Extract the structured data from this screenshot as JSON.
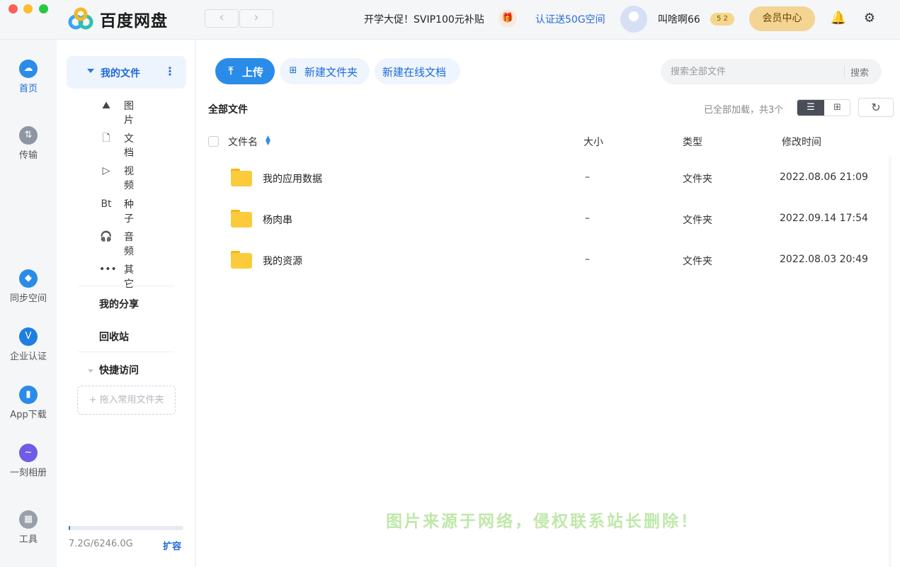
{
  "app": {
    "title": "百度网盘",
    "logo_colors": [
      "#37a3f5",
      "#2ec1a9",
      "#f5b72a"
    ]
  },
  "traffic_lights": [
    "#fe5f57",
    "#febc2e",
    "#28c840"
  ],
  "topbar": {
    "back_icon": "‹",
    "forward_icon": "›",
    "promo_text": "开学大促！SVIP100元补贴",
    "gift_icon": "🎁",
    "auth_text": "认证送50G空间",
    "username": "叫啥啊66",
    "vip_badge": "5  2",
    "member_label": "会员中心",
    "bell_icon": "🔔",
    "settings_icon": "⚙"
  },
  "leftnav": [
    {
      "label": "首页",
      "icon": "☁",
      "color": "#2a8ce8"
    },
    {
      "label": "传输",
      "icon": "⇅",
      "color": "#8f96a3"
    },
    {
      "label": "同步空间",
      "icon": "◆",
      "color": "#2a8ce8"
    },
    {
      "label": "企业认证",
      "icon": "V",
      "color": "#1f7fe0"
    },
    {
      "label": "App下载",
      "icon": "▮",
      "color": "#2a8ce8"
    },
    {
      "label": "一刻相册",
      "icon": "~",
      "color": "#6c5ce7"
    },
    {
      "label": "工具",
      "icon": "▦",
      "color": "#9aa0aa"
    }
  ],
  "sidebar": {
    "my_files": "我的文件",
    "more_icon": "⋮",
    "categories": [
      {
        "label": "图片",
        "icon": "⛰"
      },
      {
        "label": "文档",
        "icon": "🗋"
      },
      {
        "label": "视频",
        "icon": "▷"
      },
      {
        "label": "种子",
        "icon": "Bt"
      },
      {
        "label": "音频",
        "icon": "🎧"
      },
      {
        "label": "其它",
        "icon": "•••"
      }
    ],
    "my_share": "我的分享",
    "recycle": "回收站",
    "quick_access": "快捷访问",
    "drop_hint": "+ 拖入常用文件夹",
    "storage_text": "7.2G/6246.0G",
    "storage_used": 0.0012,
    "expand_label": "扩容"
  },
  "toolbar": {
    "upload_label": "上传",
    "upload_icon": "⤒",
    "new_folder_label": "新建文件夹",
    "new_folder_icon": "⊞",
    "new_doc_label": "新建在线文档",
    "search_placeholder": "搜索全部文件",
    "search_button": "搜索"
  },
  "content": {
    "breadcrumb": "全部文件",
    "loaded_text": "已全部加载，共3个",
    "list_view_icon": "☰",
    "grid_view_icon": "⊞",
    "refresh_icon": "↻",
    "columns": {
      "name": "文件名",
      "size": "大小",
      "type": "类型",
      "modified": "修改时间"
    },
    "sort_icon": "▲▼",
    "files": [
      {
        "name": "我的应用数据",
        "size": "–",
        "type": "文件夹",
        "modified": "2022.08.06 21:09"
      },
      {
        "name": "杨肉串",
        "size": "–",
        "type": "文件夹",
        "modified": "2022.09.14 17:54"
      },
      {
        "name": "我的资源",
        "size": "–",
        "type": "文件夹",
        "modified": "2022.08.03 20:49"
      }
    ]
  },
  "watermark": "图片来源于网络，侵权联系站长删除！"
}
